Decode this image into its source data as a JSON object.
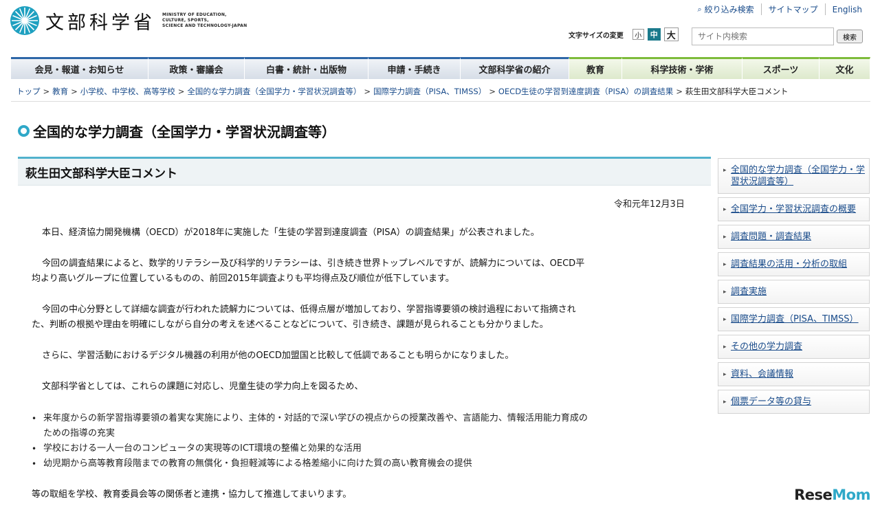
{
  "header": {
    "logo_text": "文部科学省",
    "logo_en_lines": [
      "MINISTRY OF EDUCATION,",
      "CULTURE, SPORTS,",
      "SCIENCE AND TECHNOLOGY-JAPAN"
    ],
    "util_links": [
      "絞り込み検索",
      "サイトマップ",
      "English"
    ],
    "font_size_label": "文字サイズの変更",
    "font_sizes": [
      "小",
      "中",
      "大"
    ],
    "search_placeholder": "サイト内検索",
    "search_button": "検索"
  },
  "nav": [
    "会見・報道・お知らせ",
    "政策・審議会",
    "白書・統計・出版物",
    "申請・手続き",
    "文部科学省の紹介",
    "教育",
    "科学技術・学術",
    "スポーツ",
    "文化"
  ],
  "breadcrumb": [
    "トップ",
    "教育",
    "小学校、中学校、高等学校",
    "全国的な学力調査（全国学力・学習状況調査等）",
    "国際学力調査（PISA、TIMSS）",
    "OECD生徒の学習到達度調査（PISA）の調査結果",
    "萩生田文部科学大臣コメント"
  ],
  "page_title": "全国的な学力調査（全国学力・学習状況調査等）",
  "article": {
    "heading": "萩生田文部科学大臣コメント",
    "date": "令和元年12月3日",
    "p1": "本日、経済協力開発機構（OECD）が2018年に実施した「生徒の学習到達度調査（PISA）の調査結果」が公表されました。",
    "p2a": "今回の調査結果によると、数学的リテラシー及び科学的リテラシーは、引き続き世界トップレベルですが、読解力については、OECD平",
    "p2b": "均より高いグループに位置しているものの、前回2015年調査よりも平均得点及び順位が低下しています。",
    "p3a": "今回の中心分野として詳細な調査が行われた読解力については、低得点層が増加しており、学習指導要領の検討過程において指摘され",
    "p3b": "た、判断の根拠や理由を明確にしながら自分の考えを述べることなどについて、引き続き、課題が見られることも分かりました。",
    "p4": "さらに、学習活動におけるデジタル機器の利用が他のOECD加盟国と比較して低調であることも明らかになりました。",
    "p5": "文部科学省としては、これらの課題に対応し、児童生徒の学力向上を図るため、",
    "bullets": [
      "来年度からの新学習指導要領の着実な実施により、主体的・対話的で深い学びの視点からの授業改善や、言語能力、情報活用能力育成の",
      "学校における一人一台のコンピュータの実現等のICT環境の整備と効果的な活用",
      "幼児期から高等教育段階までの教育の無償化・負担軽減等による格差縮小に向けた質の高い教育機会の提供"
    ],
    "bullet1_cont": "ための指導の充実",
    "p6": "等の取組を学校、教育委員会等の関係者と連携・協力して推進してまいります。"
  },
  "sidebar": [
    "全国的な学力調査（全国学力・学習状況調査等）",
    "全国学力・学習状況調査の概要",
    "調査問題・調査結果",
    "調査結果の活用・分析の取組",
    "調査実施",
    "国際学力調査（PISA、TIMSS）",
    "その他の学力調査",
    "資料、会議情報",
    "個票データ等の貸与"
  ],
  "watermark": {
    "a": "Rese",
    "b": "Mom"
  },
  "colors": {
    "nav_blue": "#2d67a8",
    "nav_green": "#7dbb3a",
    "accent": "#2fa8c8",
    "link": "#1a4c8b"
  }
}
